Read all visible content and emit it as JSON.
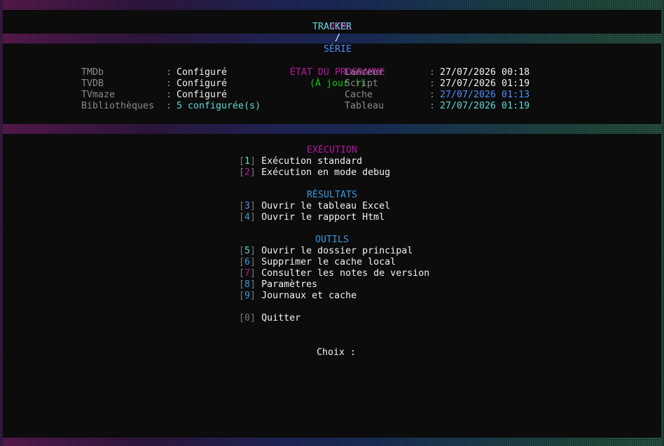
{
  "header": {
    "anime": "ANIME",
    "slash": "/",
    "serie": "SÉRIE",
    "tracker": "TRACKER"
  },
  "status": {
    "title": "ÉTAT DU PROGRAMME",
    "update": "(À jour !)",
    "left": [
      {
        "label": "TMDb",
        "value": "Configuré"
      },
      {
        "label": "TVDB",
        "value": "Configuré"
      },
      {
        "label": "TVmaze",
        "value": "Configuré"
      },
      {
        "label": "Bibliothèques",
        "value": "5 configurée(s)"
      }
    ],
    "right": [
      {
        "label": "Lanceur",
        "value": "27/07/2026 00:18"
      },
      {
        "label": "Script",
        "value": "27/07/2026 01:19"
      },
      {
        "label": "Cache",
        "value": "27/07/2026 01:13"
      },
      {
        "label": "Tableau",
        "value": "27/07/2026 01:19"
      }
    ],
    "sep": ":"
  },
  "menu": {
    "execution_title": "EXÉCUTION",
    "results_title": "RÉSULTATS",
    "tools_title": "OUTILS",
    "items": [
      {
        "key": "1",
        "label": "Exécution standard"
      },
      {
        "key": "2",
        "label": "Exécution en mode debug"
      },
      {
        "key": "3",
        "label": "Ouvrir le tableau Excel"
      },
      {
        "key": "4",
        "label": "Ouvrir le rapport Html"
      },
      {
        "key": "5",
        "label": "Ouvrir le dossier principal"
      },
      {
        "key": "6",
        "label": "Supprimer le cache local"
      },
      {
        "key": "7",
        "label": "Consulter les notes de version"
      },
      {
        "key": "8",
        "label": "Paramètres"
      },
      {
        "key": "9",
        "label": "Journaux et cache"
      },
      {
        "key": "0",
        "label": "Quitter"
      }
    ],
    "lb": "[",
    "rb": "]"
  },
  "prompt": {
    "label": "Choix :"
  }
}
